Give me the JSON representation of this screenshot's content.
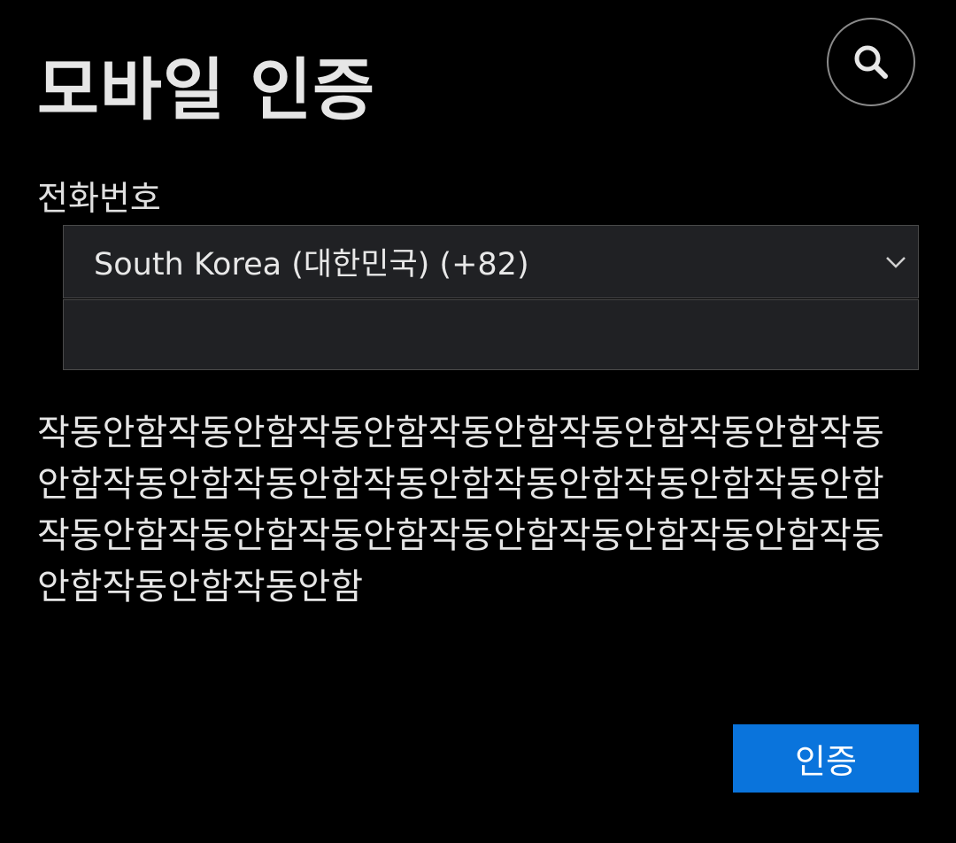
{
  "header": {
    "title": "모바일 인증",
    "search_icon": "search-icon"
  },
  "form": {
    "phone_label": "전화번호",
    "country_select": {
      "selected": "South Korea (대한민국) (+82)",
      "icon": "chevron-down-icon"
    },
    "phone_input": {
      "value": "",
      "placeholder": ""
    }
  },
  "description": "작동안함작동안함작동안함작동안함작동안함작동안함작동안함작동안함작동안함작동안함작동안함작동안함작동안함작동안함작동안함작동안함작동안함작동안함작동안함작동안함작동안함작동안함",
  "actions": {
    "verify_label": "인증"
  },
  "colors": {
    "background": "#000000",
    "field_background": "#202124",
    "accent": "#0a74dc",
    "text": "#e6e6e6"
  }
}
